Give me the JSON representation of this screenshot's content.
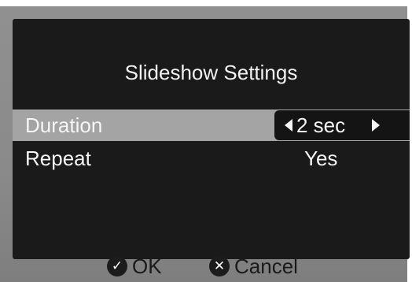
{
  "dialog": {
    "title": "Slideshow Settings"
  },
  "settings": [
    {
      "label": "Duration",
      "value": "2 sec",
      "selected": true
    },
    {
      "label": "Repeat",
      "value": "Yes",
      "selected": false
    }
  ],
  "footer": {
    "ok_label": "OK",
    "ok_icon": "check-icon",
    "cancel_label": "Cancel",
    "cancel_icon": "x-icon"
  },
  "colors": {
    "frame": "#8a8a8a",
    "panel": "#1a1a1a",
    "selection": "#a4a4a4",
    "text": "#f5f5f5"
  }
}
